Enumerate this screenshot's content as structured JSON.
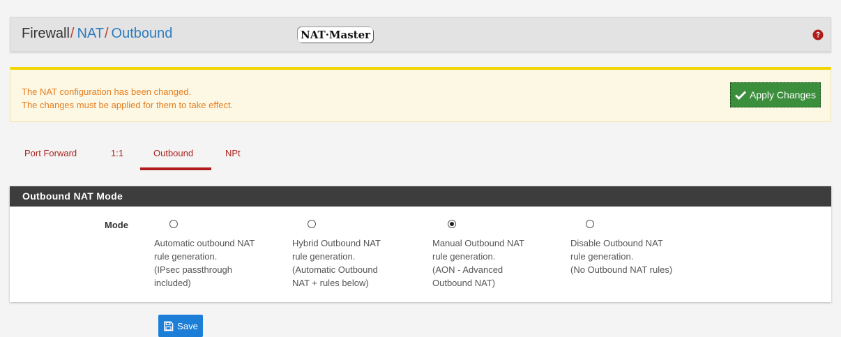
{
  "breadcrumb": {
    "root": "Firewall",
    "sep": "/",
    "level1": "NAT",
    "level2": "Outbound"
  },
  "logo_text": "NAT·Master",
  "help_icon": "question-circle-icon",
  "alert": {
    "line1": "The NAT configuration has been changed.",
    "line2": "The changes must be applied for them to take effect.",
    "apply_label": "Apply Changes",
    "apply_icon": "check-icon"
  },
  "tabs": [
    {
      "label": "Port Forward",
      "active": false
    },
    {
      "label": "1:1",
      "active": false
    },
    {
      "label": "Outbound",
      "active": true
    },
    {
      "label": "NPt",
      "active": false
    }
  ],
  "panel": {
    "title": "Outbound NAT Mode",
    "mode_label": "Mode",
    "options": [
      {
        "text": "Automatic outbound NAT\nrule generation.\n(IPsec passthrough\nincluded)",
        "checked": false
      },
      {
        "text": "Hybrid Outbound NAT\nrule generation.\n(Automatic Outbound\nNAT + rules below)",
        "checked": false
      },
      {
        "text": "Manual Outbound NAT\nrule generation.\n(AON - Advanced\nOutbound NAT)",
        "checked": true
      },
      {
        "text": "Disable Outbound NAT\nrule generation.\n(No Outbound NAT rules)",
        "checked": false
      }
    ]
  },
  "save": {
    "label": "Save",
    "icon": "floppy-disk-icon"
  },
  "colors": {
    "accent_red": "#b01c1c",
    "link_blue": "#2e7cbf",
    "alert_yellow": "#f2d600",
    "apply_green": "#3b8e3b",
    "save_blue": "#1c7ed6"
  }
}
